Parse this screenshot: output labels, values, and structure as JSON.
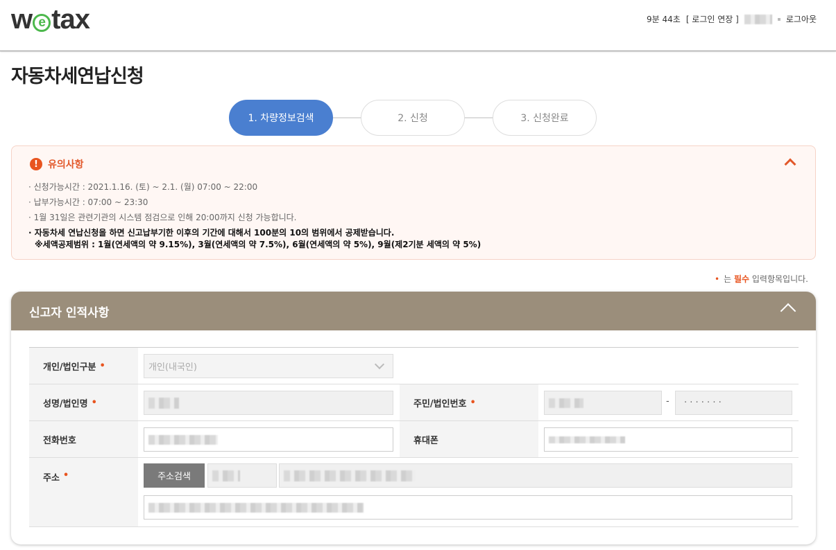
{
  "header": {
    "logo_pre": "w",
    "logo_e": "e",
    "logo_post": "tax",
    "session_timer": "9분 44초",
    "extend_login": "[ 로그인 연장 ]",
    "logout": "로그아웃"
  },
  "page": {
    "title": "자동차세연납신청"
  },
  "steps": [
    {
      "label": "1. 차량정보검색",
      "active": true
    },
    {
      "label": "2. 신청",
      "active": false
    },
    {
      "label": "3. 신청완료",
      "active": false
    }
  ],
  "notice": {
    "title": "유의사항",
    "icon": "!",
    "items": [
      "신청가능시간 : 2021.1.16. (토) ~ 2.1. (월) 07:00 ~ 22:00",
      "납부가능시간 : 07:00 ~ 23:30",
      "1월 31일은 관련기관의 시스템 점검으로 인해 20:00까지 신청 가능합니다."
    ],
    "strong_item": "자동차세 연납신청을 하면 신고납부기한 이후의 기간에 대해서 100분의 10의 범위에서 공제받습니다.",
    "strong_sub": "※세액공제범위 : 1월(연세액의 약 9.15%), 3월(연세액의 약 7.5%), 6월(연세액의 약 5%), 9월(제2기분 세액의 약 5%)"
  },
  "required_note": {
    "bullet": "•",
    "pre": "는 ",
    "highlight": "필수",
    "post": " 입력항목입니다."
  },
  "section": {
    "title": "신고자 인적사항",
    "labels": {
      "type": "개인/법인구분",
      "name": "성명/법인명",
      "id_number": "주민/법인번호",
      "phone": "전화번호",
      "mobile": "휴대폰",
      "address": "주소"
    },
    "required_mark": "•",
    "type_value": "개인(내국인)",
    "id_dash": "-",
    "id_masked": "· · · · · · ·",
    "address_search_button": "주소검색"
  },
  "colors": {
    "step_active": "#4a7fd0",
    "accent_orange": "#e8541f",
    "section_header": "#9b8e7b",
    "logo_green": "#4cb84c"
  }
}
